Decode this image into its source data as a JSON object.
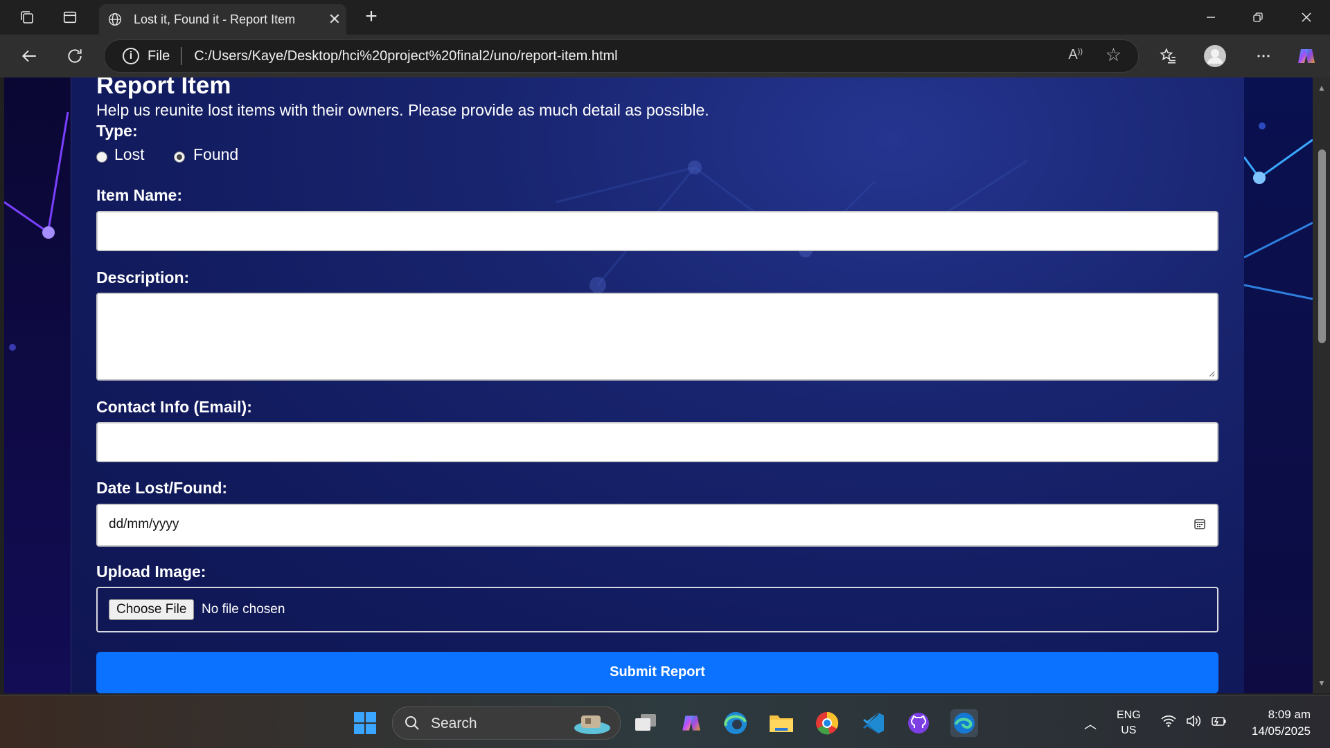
{
  "browser": {
    "tab_title": "Lost it, Found it - Report Item",
    "url_scheme": "File",
    "url": "C:/Users/Kaye/Desktop/hci%20project%20final2/uno/report-item.html"
  },
  "page": {
    "heading": "Report Item",
    "subtitle": "Help us reunite lost items with their owners. Please provide as much detail as possible.",
    "type_label": "Type:",
    "type_options": [
      "Lost",
      "Found"
    ],
    "item_name_label": "Item Name:",
    "item_name_value": "",
    "description_label": "Description:",
    "description_value": "",
    "contact_label": "Contact Info (Email):",
    "contact_value": "",
    "date_label": "Date Lost/Found:",
    "date_placeholder": "dd/mm/yyyy",
    "upload_label": "Upload Image:",
    "choose_file_label": "Choose File",
    "file_status": "No file chosen",
    "submit_label": "Submit Report"
  },
  "taskbar": {
    "search_text": "Search",
    "lang_line1": "ENG",
    "lang_line2": "US",
    "time": "8:09 am",
    "date": "14/05/2025"
  },
  "colors": {
    "submit_button": "#0a72ff",
    "page_background": "#16206a",
    "browser_chrome": "#2f2f2f"
  }
}
